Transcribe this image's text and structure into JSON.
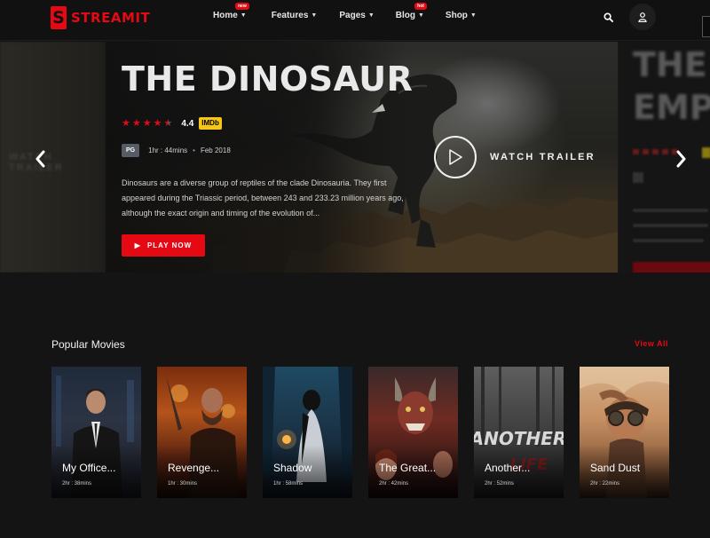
{
  "brand": {
    "logo_letter": "S",
    "name": "STREAMIT",
    "accent": "#e50914"
  },
  "nav": [
    {
      "label": "Home",
      "badge": "new"
    },
    {
      "label": "Features",
      "badge": ""
    },
    {
      "label": "Pages",
      "badge": ""
    },
    {
      "label": "Blog",
      "badge": "hot"
    },
    {
      "label": "Shop",
      "badge": ""
    }
  ],
  "header_icons": {
    "search": "search-icon",
    "user": "user-icon"
  },
  "hero": {
    "title": "THE DINOSAUR",
    "rating": "4.4",
    "stars": 4.5,
    "imdb_label": "IMDb",
    "pg": "PG",
    "duration": "1hr : 44mins",
    "date": "Feb 2018",
    "description": "Dinosaurs are a diverse group of reptiles of the clade Dinosauria. They first appeared during the Triassic period, between 243 and 233.23 million years ago, although the exact origin and timing of the evolution of...",
    "play_label": "PLAY NOW",
    "trailer_label": "WATCH TRAILER",
    "prev_slide_ghost_text": "WATCH TRAILER",
    "next_slide_ghost_title_1": "THE",
    "next_slide_ghost_title_2": "EMPI"
  },
  "popular": {
    "title": "Popular Movies",
    "view_all": "View All",
    "movies": [
      {
        "title": "My Office...",
        "time": "2hr : 38mins"
      },
      {
        "title": "Revenge...",
        "time": "1hr : 30mins"
      },
      {
        "title": "Shadow",
        "time": "1hr : 58mins"
      },
      {
        "title": "The Great...",
        "time": "2hr : 42mins"
      },
      {
        "title": "Another...",
        "time": "2hr : 52mins"
      },
      {
        "title": "Sand Dust",
        "time": "2hr : 22mins"
      }
    ]
  }
}
